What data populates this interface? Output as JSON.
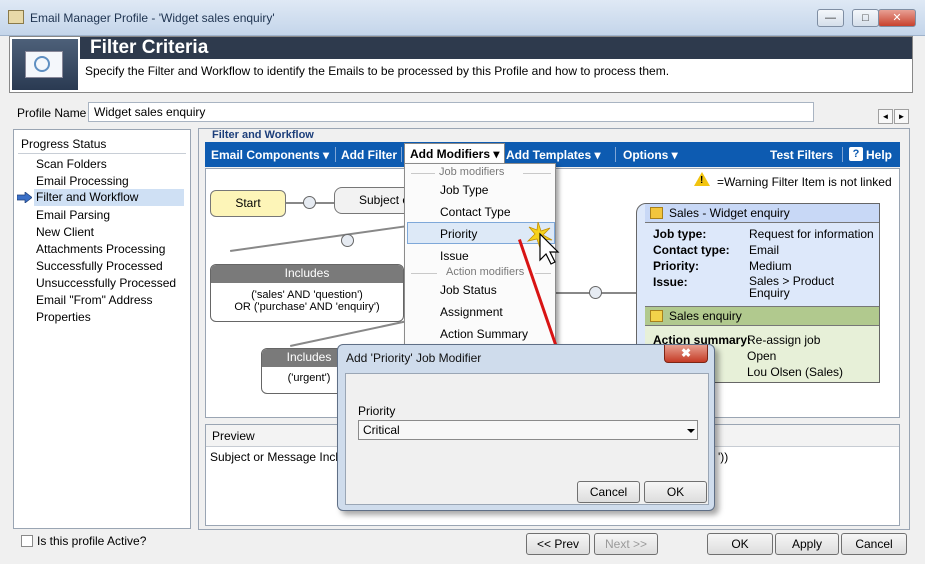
{
  "window": {
    "title": "Email Manager Profile - 'Widget sales enquiry'",
    "min_glyph": "—",
    "max_glyph": "□",
    "close_glyph": "✕"
  },
  "header": {
    "title": "Filter Criteria",
    "description": "Specify the Filter and Workflow to identify the Emails to be processed by this Profile and how to process them."
  },
  "profile": {
    "label": "Profile Name",
    "value": "Widget sales enquiry",
    "prev_glyph": "◄",
    "next_glyph": "►"
  },
  "progress": {
    "title": "Progress Status",
    "steps": [
      "Scan Folders",
      "Email Processing",
      "Filter and Workflow",
      "Email Parsing",
      "New Client",
      "Attachments Processing",
      "Successfully Processed",
      "Unsuccessfully Processed",
      "Email \"From\" Address",
      "Properties"
    ],
    "current_index": 2
  },
  "filter_workflow": {
    "legend": "Filter and Workflow",
    "toolbar": {
      "email_components": "Email Components",
      "add_filter": "Add Filter",
      "add_modifiers": "Add Modifiers",
      "add_templates": "Add Templates",
      "options": "Options",
      "test_filters": "Test Filters",
      "help": "Help",
      "help_glyph": "?",
      "arrow_glyph": "▾"
    },
    "warning": {
      "glyph": "!",
      "text": "=Warning Filter Item is not linked"
    },
    "nodes": {
      "start": "Start",
      "subject": "Subject c",
      "includes1": {
        "header": "Includes",
        "line1": "('sales' AND 'question')",
        "line2": "OR ('purchase' AND 'enquiry')"
      },
      "includes2": {
        "header": "Includes",
        "line1": "('urgent')"
      }
    },
    "side_card": {
      "header": "Sales - Widget enquiry",
      "rows": [
        {
          "label": "Job type:",
          "value": "Request for information"
        },
        {
          "label": "Contact type:",
          "value": "Email"
        },
        {
          "label": "Priority:",
          "value": "Medium"
        },
        {
          "label": "Issue:",
          "value": "Sales > Product Enquiry"
        }
      ],
      "section2_header": "Sales enquiry",
      "action_label": "Action summary:",
      "action_value": "Re-assign job",
      "status_value": "Open",
      "assignee_value": "Lou Olsen (Sales)"
    },
    "preview": {
      "title": "Preview",
      "text": "Subject or Message Include",
      "tail": "'))"
    }
  },
  "dropdown": {
    "group1": "Job modifiers",
    "items1": [
      "Job Type",
      "Contact Type",
      "Priority",
      "Issue"
    ],
    "group2": "Action modifiers",
    "items2": [
      "Job Status",
      "Assignment",
      "Action Summary"
    ]
  },
  "dialog": {
    "title": "Add 'Priority' Job Modifier",
    "close_glyph": "✖",
    "field_label": "Priority",
    "selected": "Critical",
    "cancel": "Cancel",
    "ok": "OK"
  },
  "footer": {
    "active_label": "Is this profile Active?",
    "prev": "<< Prev",
    "next": "Next >>",
    "ok": "OK",
    "apply": "Apply",
    "cancel": "Cancel"
  }
}
